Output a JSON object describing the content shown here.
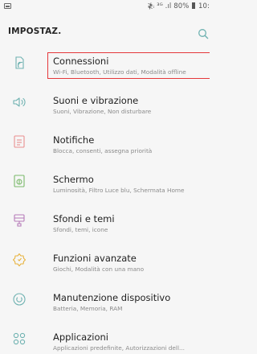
{
  "status_bar": {
    "signal_text": "≹ᵢ ³ᴳ .ıl",
    "battery": "80%",
    "time": "10:"
  },
  "header": {
    "title": "IMPOSTAZ."
  },
  "colors": {
    "accent": "#6fb2b1",
    "selection_border": "#e5383b"
  },
  "settings": [
    {
      "title": "Connessioni",
      "subtitle": "Wi-Fi, Bluetooth, Utilizzo dati, Modalità offline",
      "icon": "connections-icon",
      "selected": true
    },
    {
      "title": "Suoni e vibrazione",
      "subtitle": "Suoni, Vibrazione, Non disturbare",
      "icon": "sound-icon",
      "selected": false
    },
    {
      "title": "Notifiche",
      "subtitle": "Blocca, consenti, assegna priorità",
      "icon": "notifications-icon",
      "selected": false
    },
    {
      "title": "Schermo",
      "subtitle": "Luminosità, Filtro Luce blu, Schermata Home",
      "icon": "display-icon",
      "selected": false
    },
    {
      "title": "Sfondi e temi",
      "subtitle": "Sfondi, temi, icone",
      "icon": "wallpaper-icon",
      "selected": false
    },
    {
      "title": "Funzioni avanzate",
      "subtitle": "Giochi, Modalità con una mano",
      "icon": "advanced-features-icon",
      "selected": false
    },
    {
      "title": "Manutenzione dispositivo",
      "subtitle": "Batteria, Memoria, RAM",
      "icon": "device-maintenance-icon",
      "selected": false
    },
    {
      "title": "Applicazioni",
      "subtitle": "Applicazioni predefinite, Autorizzazioni dell...",
      "icon": "apps-icon",
      "selected": false
    }
  ]
}
